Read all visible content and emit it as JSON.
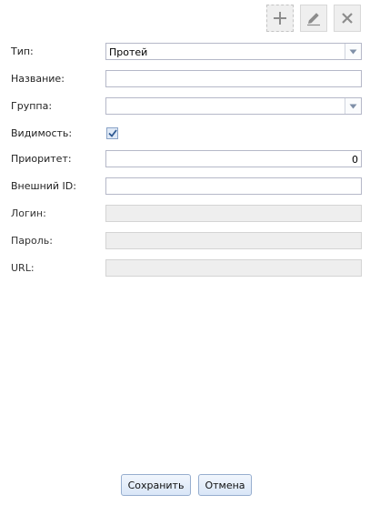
{
  "toolbar": {
    "add_icon": "plus-icon",
    "edit_icon": "pencil-icon",
    "delete_icon": "close-icon"
  },
  "form": {
    "type": {
      "label": "Тип:",
      "value": "Протей"
    },
    "name": {
      "label": "Название:",
      "value": ""
    },
    "group": {
      "label": "Группа:",
      "value": ""
    },
    "visibility": {
      "label": "Видимость:",
      "checked": true
    },
    "priority": {
      "label": "Приоритет:",
      "value": "0"
    },
    "external_id": {
      "label": "Внешний ID:",
      "value": ""
    },
    "login": {
      "label": "Логин:",
      "value": ""
    },
    "password": {
      "label": "Пароль:",
      "value": ""
    },
    "url": {
      "label": "URL:",
      "value": ""
    }
  },
  "buttons": {
    "save": "Сохранить",
    "cancel": "Отмена"
  },
  "colors": {
    "button_border": "#97aecf",
    "disabled_field": "#eeeeee",
    "field_border": "#b5b8c8"
  }
}
